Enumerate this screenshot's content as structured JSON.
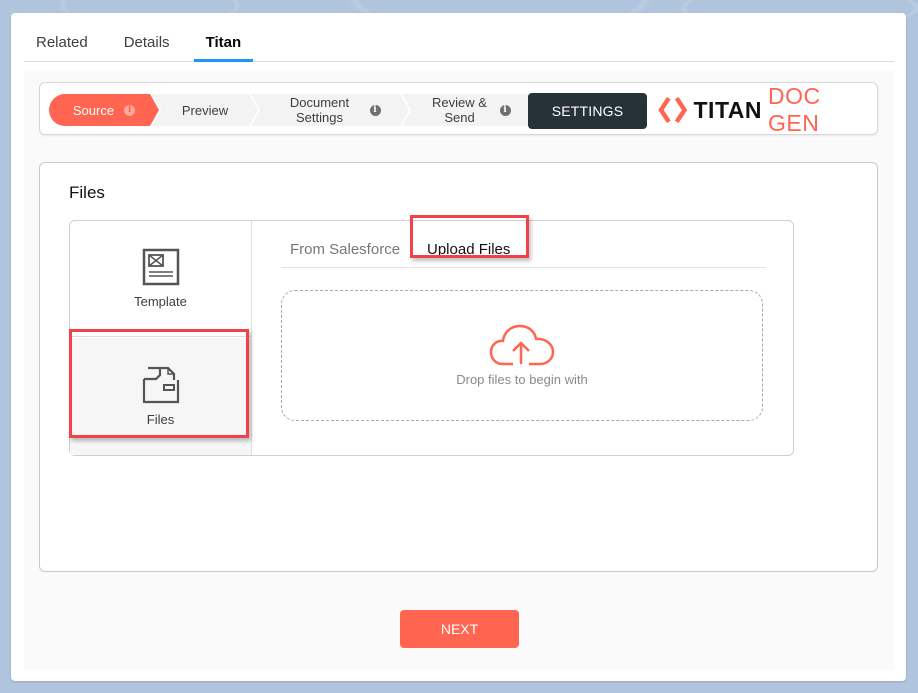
{
  "record_tabs": [
    {
      "label": "Related",
      "active": false
    },
    {
      "label": "Details",
      "active": false
    },
    {
      "label": "Titan",
      "active": true
    }
  ],
  "stepper": {
    "steps": [
      {
        "label": "Source",
        "has_info": true,
        "active": true
      },
      {
        "label": "Preview",
        "has_info": false,
        "active": false
      },
      {
        "label": "Document Settings",
        "has_info": true,
        "active": false
      },
      {
        "label": "Review & Send",
        "has_info": true,
        "active": false
      }
    ],
    "info_glyph": "i",
    "settings_label": "SETTINGS"
  },
  "logo": {
    "part1": "TITAN",
    "part2": "DOC GEN",
    "accent_color": "#ff6550"
  },
  "files_panel": {
    "title": "Files",
    "sidebar": [
      {
        "label": "Template",
        "icon": "template-icon",
        "selected": false
      },
      {
        "label": "Files",
        "icon": "files-folder-icon",
        "selected": true
      }
    ],
    "subtabs": [
      {
        "label": "From Salesforce",
        "active": false
      },
      {
        "label": "Upload Files",
        "active": true
      }
    ],
    "dropzone_text": "Drop files to begin with",
    "dropzone_icon": "cloud-upload-icon"
  },
  "next_label": "NEXT",
  "colors": {
    "accent": "#ff6550",
    "dark": "#263238",
    "highlight": "#f0424a",
    "tab_indicator": "#1b96ff"
  }
}
